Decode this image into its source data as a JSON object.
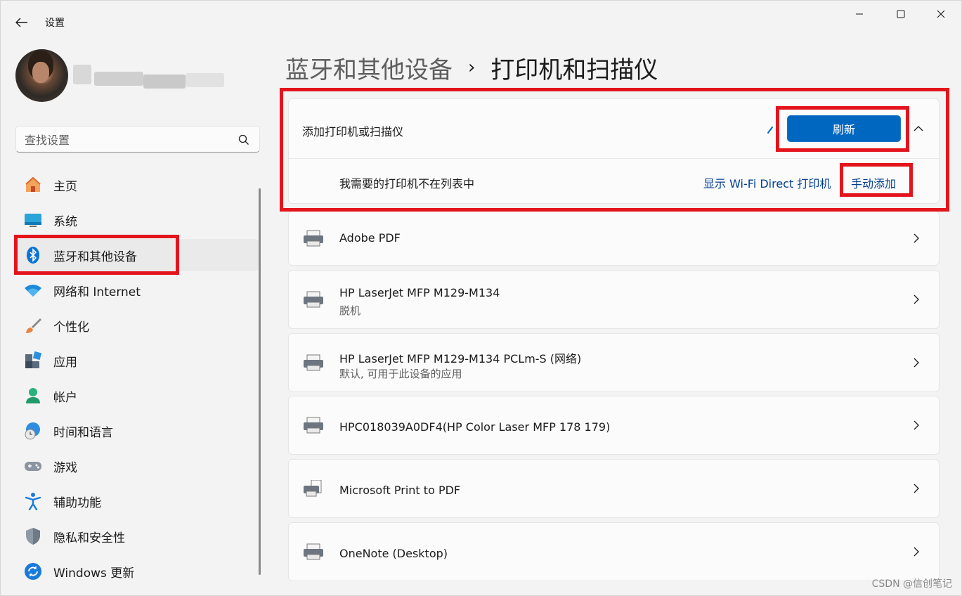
{
  "window": {
    "app_title": "设置"
  },
  "sidebar": {
    "search_placeholder": "查找设置",
    "items": [
      {
        "label": "主页",
        "icon": "home-icon"
      },
      {
        "label": "系统",
        "icon": "system-icon"
      },
      {
        "label": "蓝牙和其他设备",
        "icon": "bluetooth-icon",
        "active": true
      },
      {
        "label": "网络和 Internet",
        "icon": "wifi-icon"
      },
      {
        "label": "个性化",
        "icon": "brush-icon"
      },
      {
        "label": "应用",
        "icon": "apps-icon"
      },
      {
        "label": "帐户",
        "icon": "account-icon"
      },
      {
        "label": "时间和语言",
        "icon": "globe-clock-icon"
      },
      {
        "label": "游戏",
        "icon": "gamepad-icon"
      },
      {
        "label": "辅助功能",
        "icon": "accessibility-icon"
      },
      {
        "label": "隐私和安全性",
        "icon": "shield-icon"
      },
      {
        "label": "Windows 更新",
        "icon": "update-icon"
      }
    ]
  },
  "breadcrumb": {
    "parent": "蓝牙和其他设备",
    "separator": "›",
    "current": "打印机和扫描仪"
  },
  "add_printer": {
    "title": "添加打印机或扫描仪",
    "refresh_label": "刷新",
    "not_listed": "我需要的打印机不在列表中",
    "wifi_direct_link": "显示 Wi-Fi Direct 打印机",
    "manual_add_link": "手动添加"
  },
  "printers": [
    {
      "name": "Adobe PDF",
      "status": ""
    },
    {
      "name": "HP LaserJet MFP M129-M134",
      "status": "脱机"
    },
    {
      "name": "HP LaserJet MFP M129-M134 PCLm-S (网络)",
      "status": "默认, 可用于此设备的应用"
    },
    {
      "name": "HPC018039A0DF4(HP Color Laser MFP 178 179)",
      "status": ""
    },
    {
      "name": "Microsoft Print to PDF",
      "status": ""
    },
    {
      "name": "OneNote (Desktop)",
      "status": ""
    }
  ],
  "watermark": "CSDN @信创笔记",
  "colors": {
    "accent": "#0067c0",
    "highlight": "#e3141c",
    "link": "#003e92"
  }
}
